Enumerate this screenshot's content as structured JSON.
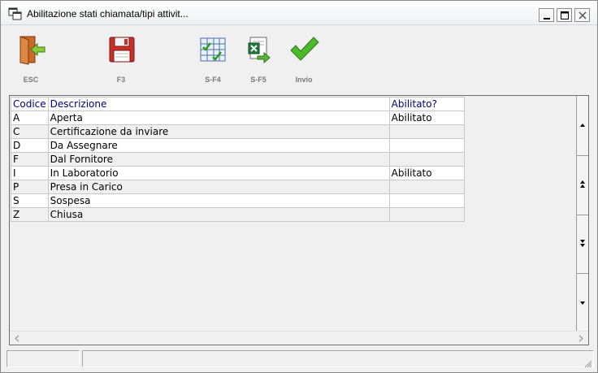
{
  "window": {
    "title": "Abilitazione stati chiamata/tipi attivit..."
  },
  "toolbar": {
    "buttons": [
      {
        "key": "esc",
        "label": "ESC",
        "icon": "exit-door-icon"
      },
      {
        "key": "f3",
        "label": "F3",
        "icon": "save-floppy-icon"
      },
      {
        "key": "sf4",
        "label": "S-F4",
        "icon": "grid-check-icon"
      },
      {
        "key": "sf5",
        "label": "S-F5",
        "icon": "excel-export-icon"
      },
      {
        "key": "invio",
        "label": "Invio",
        "icon": "checkmark-icon"
      }
    ]
  },
  "grid": {
    "headers": [
      "Codice",
      "Descrizione",
      "Abilitato?"
    ],
    "rows": [
      {
        "codice": "A",
        "descrizione": "Aperta",
        "abilitato": "Abilitato"
      },
      {
        "codice": "C",
        "descrizione": "Certificazione da inviare",
        "abilitato": ""
      },
      {
        "codice": "D",
        "descrizione": "Da Assegnare",
        "abilitato": ""
      },
      {
        "codice": "F",
        "descrizione": "Dal Fornitore",
        "abilitato": ""
      },
      {
        "codice": "I",
        "descrizione": "In Laboratorio",
        "abilitato": "Abilitato"
      },
      {
        "codice": "P",
        "descrizione": "Presa in Carico",
        "abilitato": ""
      },
      {
        "codice": "S",
        "descrizione": "Sospesa",
        "abilitato": ""
      },
      {
        "codice": "Z",
        "descrizione": "Chiusa",
        "abilitato": ""
      }
    ]
  },
  "colors": {
    "header_text": "#00007a",
    "check_green": "#2e9a1c"
  }
}
